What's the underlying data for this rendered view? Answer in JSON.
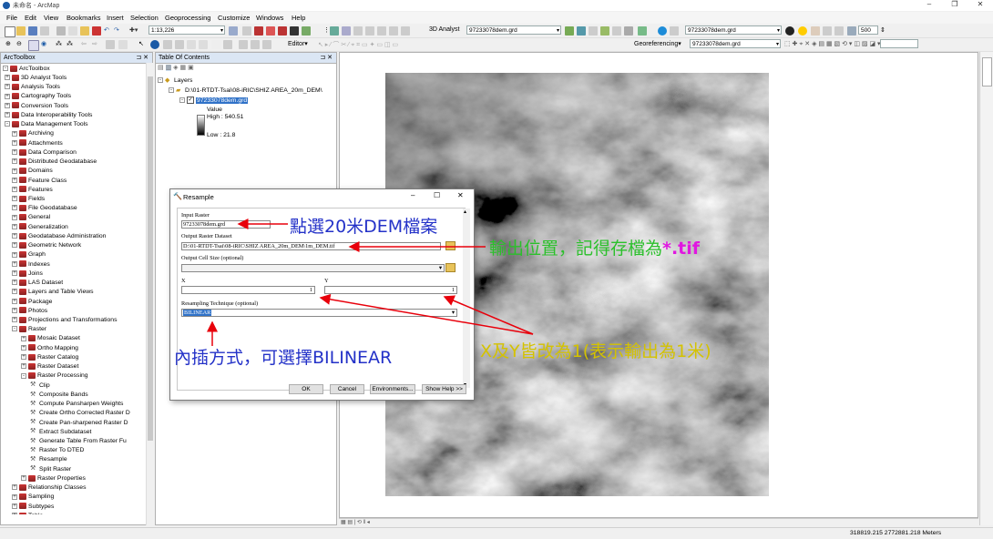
{
  "window": {
    "title": "未命名 - ArcMap"
  },
  "menu": [
    "File",
    "Edit",
    "View",
    "Bookmarks",
    "Insert",
    "Selection",
    "Geoprocessing",
    "Customize",
    "Windows",
    "Help"
  ],
  "toolbar": {
    "scale": "1:13,226",
    "analyst_label": "3D Analyst",
    "layer_combo": "97233078dem.grd",
    "zoom_value": "500",
    "editor_label": "Editor",
    "georef_label": "Georeferencing",
    "georef_combo": "97233078dem.grd",
    "layer_combo2": "97233078dem.grd"
  },
  "arctoolbox": {
    "title": "ArcToolbox",
    "root": "ArcToolbox",
    "items": [
      {
        "label": "3D Analyst Tools",
        "level": 1,
        "exp": "+"
      },
      {
        "label": "Analysis Tools",
        "level": 1,
        "exp": "+"
      },
      {
        "label": "Cartography Tools",
        "level": 1,
        "exp": "+"
      },
      {
        "label": "Conversion Tools",
        "level": 1,
        "exp": "+"
      },
      {
        "label": "Data Interoperability Tools",
        "level": 1,
        "exp": "+"
      },
      {
        "label": "Data Management Tools",
        "level": 1,
        "exp": "-"
      },
      {
        "label": "Archiving",
        "level": 2,
        "exp": "+"
      },
      {
        "label": "Attachments",
        "level": 2,
        "exp": "+"
      },
      {
        "label": "Data Comparison",
        "level": 2,
        "exp": "+"
      },
      {
        "label": "Distributed Geodatabase",
        "level": 2,
        "exp": "+"
      },
      {
        "label": "Domains",
        "level": 2,
        "exp": "+"
      },
      {
        "label": "Feature Class",
        "level": 2,
        "exp": "+"
      },
      {
        "label": "Features",
        "level": 2,
        "exp": "+"
      },
      {
        "label": "Fields",
        "level": 2,
        "exp": "+"
      },
      {
        "label": "File Geodatabase",
        "level": 2,
        "exp": "+"
      },
      {
        "label": "General",
        "level": 2,
        "exp": "+"
      },
      {
        "label": "Generalization",
        "level": 2,
        "exp": "+"
      },
      {
        "label": "Geodatabase Administration",
        "level": 2,
        "exp": "+"
      },
      {
        "label": "Geometric Network",
        "level": 2,
        "exp": "+"
      },
      {
        "label": "Graph",
        "level": 2,
        "exp": "+"
      },
      {
        "label": "Indexes",
        "level": 2,
        "exp": "+"
      },
      {
        "label": "Joins",
        "level": 2,
        "exp": "+"
      },
      {
        "label": "LAS Dataset",
        "level": 2,
        "exp": "+"
      },
      {
        "label": "Layers and Table Views",
        "level": 2,
        "exp": "+"
      },
      {
        "label": "Package",
        "level": 2,
        "exp": "+"
      },
      {
        "label": "Photos",
        "level": 2,
        "exp": "+"
      },
      {
        "label": "Projections and Transformations",
        "level": 2,
        "exp": "+"
      },
      {
        "label": "Raster",
        "level": 2,
        "exp": "-"
      },
      {
        "label": "Mosaic Dataset",
        "level": 3,
        "exp": "+"
      },
      {
        "label": "Ortho Mapping",
        "level": 3,
        "exp": "+"
      },
      {
        "label": "Raster Catalog",
        "level": 3,
        "exp": "+"
      },
      {
        "label": "Raster Dataset",
        "level": 3,
        "exp": "+"
      },
      {
        "label": "Raster Processing",
        "level": 3,
        "exp": "-"
      },
      {
        "label": "Clip",
        "level": 4,
        "exp": ""
      },
      {
        "label": "Composite Bands",
        "level": 4,
        "exp": ""
      },
      {
        "label": "Compute Pansharpen Weights",
        "level": 4,
        "exp": ""
      },
      {
        "label": "Create Ortho Corrected Raster D",
        "level": 4,
        "exp": ""
      },
      {
        "label": "Create Pan-sharpened Raster D",
        "level": 4,
        "exp": ""
      },
      {
        "label": "Extract Subdataset",
        "level": 4,
        "exp": ""
      },
      {
        "label": "Generate Table From Raster Fu",
        "level": 4,
        "exp": ""
      },
      {
        "label": "Raster To DTED",
        "level": 4,
        "exp": ""
      },
      {
        "label": "Resample",
        "level": 4,
        "exp": ""
      },
      {
        "label": "Split Raster",
        "level": 4,
        "exp": ""
      },
      {
        "label": "Raster Properties",
        "level": 3,
        "exp": "+"
      },
      {
        "label": "Relationship Classes",
        "level": 2,
        "exp": "+"
      },
      {
        "label": "Sampling",
        "level": 2,
        "exp": "+"
      },
      {
        "label": "Subtypes",
        "level": 2,
        "exp": "+"
      },
      {
        "label": "Table",
        "level": 2,
        "exp": "+"
      }
    ]
  },
  "toc": {
    "title": "Table Of Contents",
    "layers_label": "Layers",
    "path": "D:\\01-RTDT-Tsai\\08-iRIC\\SHIZ AREA_20m_DEM\\",
    "layer_name": "97233078dem.grd",
    "value_label": "Value",
    "high": "High : 540.51",
    "low": "Low : 21.8"
  },
  "dialog": {
    "title": "Resample",
    "input_label": "Input Raster",
    "input_value": "97233078dem.grd",
    "output_label": "Output Raster Dataset",
    "output_value": "D:\\01-RTDT-Tsai\\08-iRIC\\SHIZ AREA_20m_DEM\\1m_DEM.tif",
    "cellsize_label": "Output Cell Size (optional)",
    "x_label": "X",
    "x_value": "1",
    "y_label": "Y",
    "y_value": "1",
    "resampling_label": "Resampling Technique (optional)",
    "resampling_value": "BILINEAR",
    "ok": "OK",
    "cancel": "Cancel",
    "environments": "Environments...",
    "show_help": "Show Help >>"
  },
  "annotations": {
    "input_note": "點選20米DEM檔案",
    "output_note": "輸出位置，記得存檔為",
    "output_ext": "*.tif",
    "xy_note": "X及Y皆改為1(表示輸出為1米)",
    "resample_note": "內插方式，可選擇BILINEAR"
  },
  "status": {
    "coords": "318819.215  2772881.218 Meters"
  },
  "colors": {
    "annotation_red": "#e8000b",
    "annotation_green": "#2bc02b",
    "annotation_yellow": "#d4c200",
    "annotation_blue": "#2432c8",
    "annotation_magenta": "#e017e0"
  }
}
